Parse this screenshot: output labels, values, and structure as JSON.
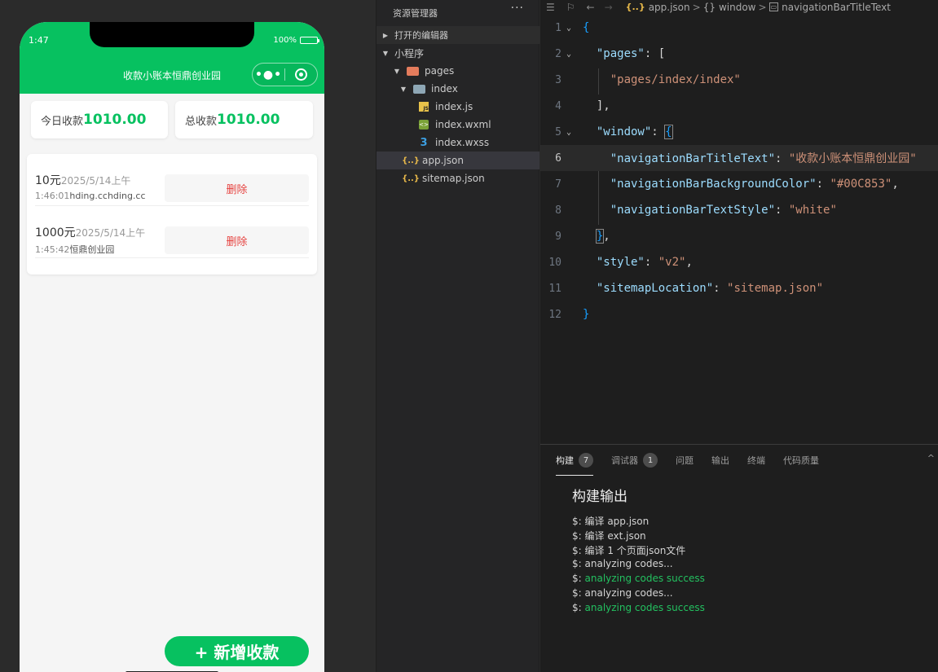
{
  "simulator": {
    "status_time": "1:47",
    "battery": "100%",
    "nav_title": "收款小账本恒鼎创业园",
    "capsule_more": "•●•",
    "today_label": "今日收款",
    "today_value": "1010.00",
    "total_label": "总收款",
    "total_value": "1010.00",
    "records": [
      {
        "amount": "10元",
        "date": "2025/5/14上午",
        "time": "1:46:01",
        "payer": "hding.cchding.cc",
        "delete_label": "删除"
      },
      {
        "amount": "1000元",
        "date": "2025/5/14上午",
        "time": "1:45:42",
        "payer": "恒鼎创业园",
        "delete_label": "删除"
      }
    ],
    "fab_label": "+ 新增收款"
  },
  "explorer": {
    "title": "资源管理器",
    "more": "···",
    "sections": {
      "open_editors": "打开的编辑器",
      "project": "小程序"
    },
    "tree": {
      "pages": "pages",
      "index_folder": "index",
      "index_js": "index.js",
      "index_wxml": "index.wxml",
      "index_wxss": "index.wxss",
      "app_json": "app.json",
      "sitemap_json": "sitemap.json"
    }
  },
  "editor": {
    "breadcrumb": {
      "file": "app.json",
      "obj": "window",
      "prop": "navigationBarTitleText"
    },
    "line_numbers": [
      "1",
      "2",
      "3",
      "4",
      "5",
      "6",
      "7",
      "8",
      "9",
      "10",
      "11",
      "12"
    ],
    "current_line": 6,
    "code": {
      "l1": "{",
      "l2_key": "\"pages\"",
      "l2_rest": ": [",
      "l3": "\"pages/index/index\"",
      "l4": "],",
      "l5_key": "\"window\"",
      "l5_rest": ": ",
      "l5_brace": "{",
      "l6_key": "\"navigationBarTitleText\"",
      "l6_val": "\"收款小账本恒鼎创业园\"",
      "l7_key": "\"navigationBarBackgroundColor\"",
      "l7_val": "\"#00C853\"",
      "l8_key": "\"navigationBarTextStyle\"",
      "l8_val": "\"white\"",
      "l9_brace": "}",
      "l9_rest": ",",
      "l10_key": "\"style\"",
      "l10_val": "\"v2\"",
      "l11_key": "\"sitemapLocation\"",
      "l11_val": "\"sitemap.json\"",
      "l12": "}"
    }
  },
  "panel": {
    "tabs": [
      {
        "label": "构建",
        "badge": "7"
      },
      {
        "label": "调试器",
        "badge": "1"
      },
      {
        "label": "问题"
      },
      {
        "label": "输出"
      },
      {
        "label": "终端"
      },
      {
        "label": "代码质量"
      }
    ],
    "output_title": "构建输出",
    "output_lines": [
      {
        "prefix": "$: ",
        "text": "编译 app.json"
      },
      {
        "prefix": "$: ",
        "text": "编译 ext.json"
      },
      {
        "prefix": "$: ",
        "text": "编译 1 个页面json文件"
      },
      {
        "prefix": "$: ",
        "text": "analyzing codes..."
      },
      {
        "prefix": "$: ",
        "text": "analyzing codes success"
      },
      {
        "prefix": "$: ",
        "text": "analyzing codes..."
      },
      {
        "prefix": "$: ",
        "text": "analyzing codes success"
      }
    ]
  },
  "colors": {
    "brand_green": "#07c160",
    "delete_red": "#e64340",
    "success_green": "#23c160"
  },
  "icons": [
    "list-icon",
    "bookmark-icon",
    "back-arrow-icon",
    "forward-arrow-icon",
    "json-file-icon",
    "braces-icon",
    "property-icon"
  ]
}
